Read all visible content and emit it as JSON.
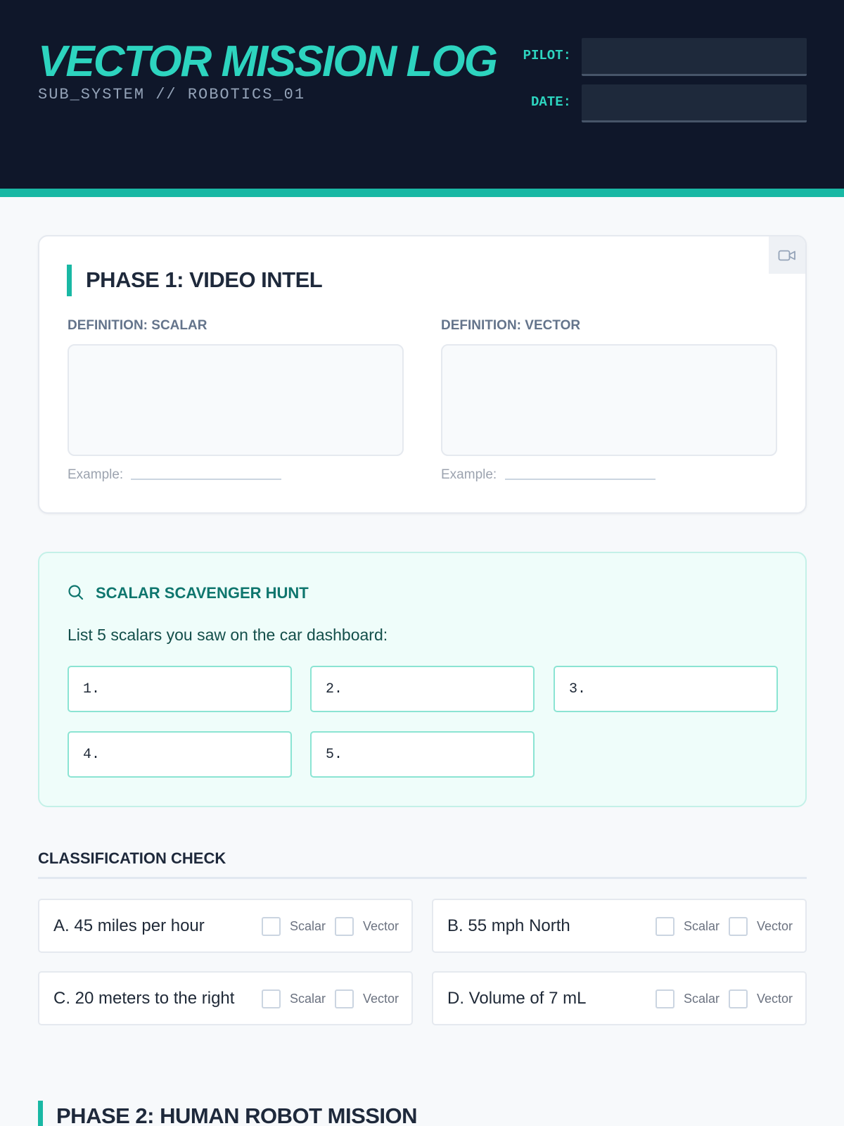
{
  "header": {
    "title": "VECTOR MISSION LOG",
    "subtitle": "SUB_SYSTEM // ROBOTICS_01",
    "pilot_label": "PILOT:",
    "pilot_value": "",
    "date_label": "DATE:",
    "date_value": "",
    "colors": {
      "background": "#0f172a",
      "accent": "#2dd4bf",
      "bar": "#19b8a4"
    }
  },
  "phase1": {
    "title": "PHASE 1: VIDEO INTEL",
    "video_icon": "video-camera-icon",
    "scalar": {
      "label": "DEFINITION: SCALAR",
      "value": "",
      "example_label": "Example:",
      "example_value": ""
    },
    "vector": {
      "label": "DEFINITION: VECTOR",
      "value": "",
      "example_label": "Example:",
      "example_value": ""
    }
  },
  "hunt": {
    "icon": "search-icon",
    "title": "SCALAR SCAVENGER HUNT",
    "prompt": "List 5 scalars you saw on the car dashboard:",
    "slots": [
      "1.",
      "2.",
      "3.",
      "4.",
      "5."
    ]
  },
  "classification": {
    "title": "CLASSIFICATION CHECK",
    "option_scalar": "Scalar",
    "option_vector": "Vector",
    "items": [
      {
        "text": "A. 45 miles per hour",
        "scalar_checked": false,
        "vector_checked": false
      },
      {
        "text": "B. 55 mph North",
        "scalar_checked": false,
        "vector_checked": false
      },
      {
        "text": "C. 20 meters to the right",
        "scalar_checked": false,
        "vector_checked": false
      },
      {
        "text": "D. Volume of 7 mL",
        "scalar_checked": false,
        "vector_checked": false
      }
    ]
  },
  "phase2": {
    "title": "PHASE 2: HUMAN ROBOT MISSION"
  }
}
